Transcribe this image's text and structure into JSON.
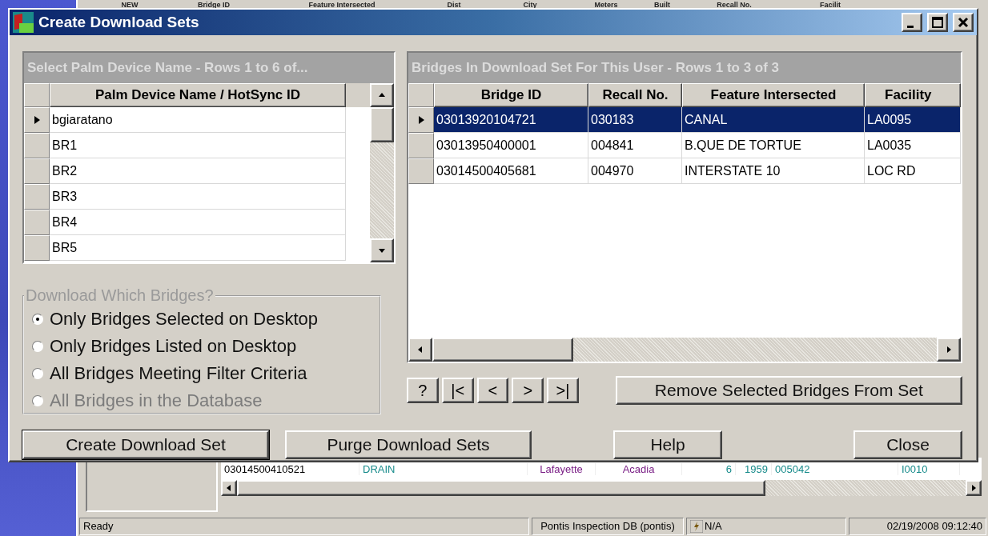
{
  "background_window": {
    "header_columns": [
      "NEW",
      "Bridge ID",
      "Feature Intersected",
      "Dist",
      "City",
      "Meters",
      "Built",
      "Recall No.",
      "Facilit"
    ],
    "row": [
      {
        "text": "03014500410521",
        "color": "#000000"
      },
      {
        "text": "DRAIN",
        "color": "#178b8b"
      },
      {
        "text": "Lafayette",
        "color": "#7a1f86"
      },
      {
        "text": "Acadia",
        "color": "#7a1f86"
      },
      {
        "text": "6",
        "color": "#178b8b"
      },
      {
        "text": "1959",
        "color": "#178b8b"
      },
      {
        "text": "005042",
        "color": "#178b8b"
      },
      {
        "text": "I0010",
        "color": "#178b8b"
      }
    ],
    "status_bar": {
      "message": "Ready",
      "database": "Pontis Inspection DB (pontis)",
      "mode": "N/A",
      "datetime": "02/19/2008 09:12:40"
    }
  },
  "dialog": {
    "title": "Create Download Sets",
    "devices_panel": {
      "caption": "Select Palm Device Name - Rows 1 to 6 of...",
      "column": "Palm Device Name / HotSync ID",
      "rows": [
        {
          "name": "bgiaratano",
          "selected": true
        },
        {
          "name": "BR1",
          "selected": false
        },
        {
          "name": "BR2",
          "selected": false
        },
        {
          "name": "BR3",
          "selected": false
        },
        {
          "name": "BR4",
          "selected": false
        },
        {
          "name": "BR5",
          "selected": false
        }
      ]
    },
    "bridges_panel": {
      "caption": "Bridges In Download Set For This User - Rows 1 to 3 of 3",
      "columns": [
        "Bridge ID",
        "Recall No.",
        "Feature Intersected",
        "Facility"
      ],
      "rows": [
        {
          "cells": [
            "03013920104721",
            "030183",
            "CANAL",
            "LA0095"
          ],
          "selected": true
        },
        {
          "cells": [
            "03013950400001",
            "004841",
            "B.QUE DE TORTUE",
            "LA0035"
          ],
          "selected": false
        },
        {
          "cells": [
            "03014500405681",
            "004970",
            "INTERSTATE 10",
            "LOC RD"
          ],
          "selected": false
        }
      ]
    },
    "download_which": {
      "legend": "Download Which Bridges?",
      "options": [
        {
          "label": "Only Bridges Selected on Desktop",
          "selected": true,
          "disabled": false
        },
        {
          "label": "Only Bridges Listed on Desktop",
          "selected": false,
          "disabled": false
        },
        {
          "label": "All Bridges Meeting Filter Criteria",
          "selected": false,
          "disabled": false
        },
        {
          "label": "All Bridges in the Database",
          "selected": false,
          "disabled": true
        }
      ]
    },
    "nav_buttons": [
      "?",
      "|<",
      "<",
      ">",
      ">|"
    ],
    "remove_button": "Remove Selected Bridges From Set",
    "buttons": [
      {
        "label": "Create Download Set",
        "default": true
      },
      {
        "label": "Purge Download Sets",
        "default": false
      },
      {
        "label": "Help",
        "default": false
      },
      {
        "label": "Close",
        "default": false
      }
    ]
  }
}
